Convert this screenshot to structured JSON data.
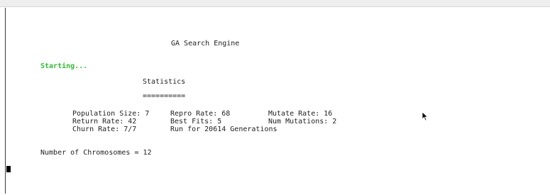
{
  "terminal": {
    "title": "GA Search Engine",
    "status": "Starting...",
    "stats_heading": "Statistics",
    "stats_underline": "==========",
    "stats": {
      "population_size": "Population Size: 7",
      "repro_rate": "Repro Rate: 68",
      "mutate_rate": "Mutate Rate: 16",
      "return_rate": "Return Rate: 42",
      "best_fits": "Best Fits: 5",
      "num_mutations": "Num Mutations: 2",
      "churn_rate": "Churn Rate: 7/7",
      "run_for": "Run for 20614 Generations"
    },
    "chromosomes": "Number of Chromosomes = 12"
  },
  "colors": {
    "status_green": "#2fbf2f",
    "text": "#222222",
    "background": "#ffffff"
  },
  "icons": {
    "cursor": "text-cursor-block",
    "pointer": "mouse-pointer-icon"
  }
}
